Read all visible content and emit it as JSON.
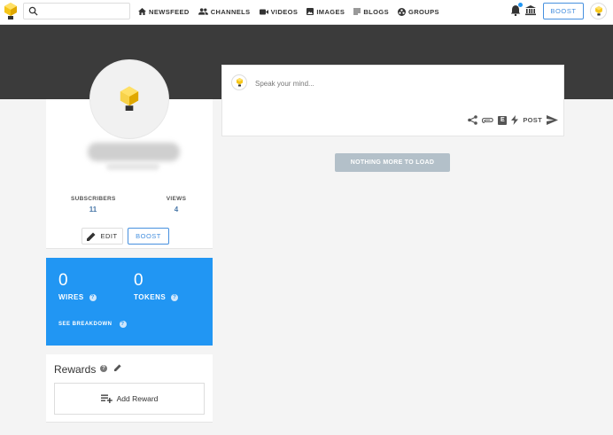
{
  "search": {
    "placeholder": "",
    "value": ""
  },
  "nav": [
    {
      "label": "NEWSFEED",
      "icon": "home-icon"
    },
    {
      "label": "CHANNELS",
      "icon": "people-icon"
    },
    {
      "label": "VIDEOS",
      "icon": "video-camera-icon"
    },
    {
      "label": "IMAGES",
      "icon": "image-icon"
    },
    {
      "label": "BLOGS",
      "icon": "text-lines-icon"
    },
    {
      "label": "GROUPS",
      "icon": "groups-icon"
    }
  ],
  "topbar": {
    "boost_label": "BOOST",
    "notification_dot_color": "#2196f3"
  },
  "profile": {
    "stats": [
      {
        "label": "SUBSCRIBERS",
        "value": "11"
      },
      {
        "label": "VIEWS",
        "value": "4"
      }
    ],
    "edit_label": "EDIT",
    "boost_label": "BOOST"
  },
  "wallet": {
    "wires_value": "0",
    "wires_label": "WIRES",
    "tokens_value": "0",
    "tokens_label": "TOKENS",
    "breakdown_label": "SEE BREAKDOWN",
    "color": "#2196f3"
  },
  "rewards": {
    "title": "Rewards",
    "add_label": "Add Reward"
  },
  "composer": {
    "placeholder": "Speak your mind...",
    "post_label": "POST"
  },
  "feed": {
    "nothing_more_label": "NOTHING MORE TO LOAD"
  },
  "colors": {
    "accent": "#4690df",
    "banner": "#3b3b3b"
  }
}
